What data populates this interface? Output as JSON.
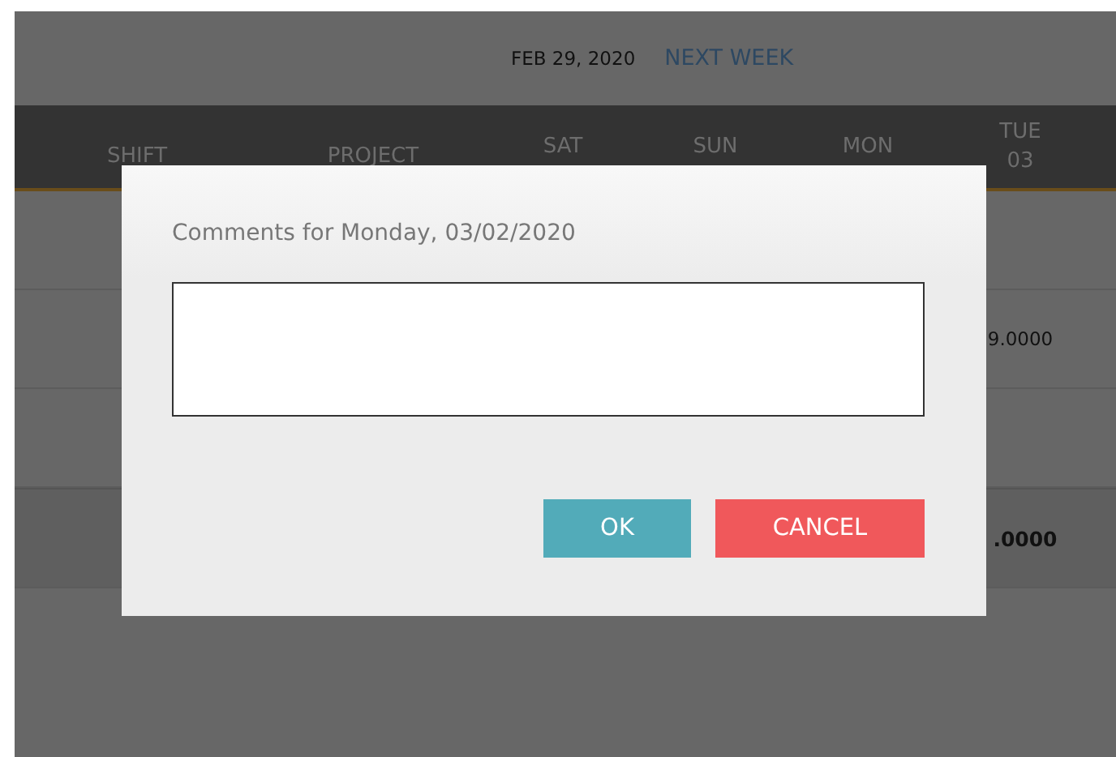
{
  "top_bar": {
    "date": "FEB 29, 2020",
    "next_link": "NEXT WEEK"
  },
  "table": {
    "columns": [
      {
        "label": "SHIFT"
      },
      {
        "label": "PROJECT"
      },
      {
        "label": "SAT"
      },
      {
        "label": "SUN"
      },
      {
        "label": "MON"
      },
      {
        "label": "TUE",
        "sub": "03"
      }
    ],
    "rows": [
      {
        "kind": "normal",
        "tue": ""
      },
      {
        "kind": "normal",
        "tue": "9.0000"
      },
      {
        "kind": "normal",
        "tue": ""
      },
      {
        "kind": "total",
        "tue": ".0000"
      }
    ]
  },
  "dialog": {
    "title": "Comments for Monday, 03/02/2020",
    "buttons": [
      {
        "label": "OK",
        "kind": "primary"
      },
      {
        "label": "CANCEL",
        "kind": "danger"
      }
    ]
  }
}
